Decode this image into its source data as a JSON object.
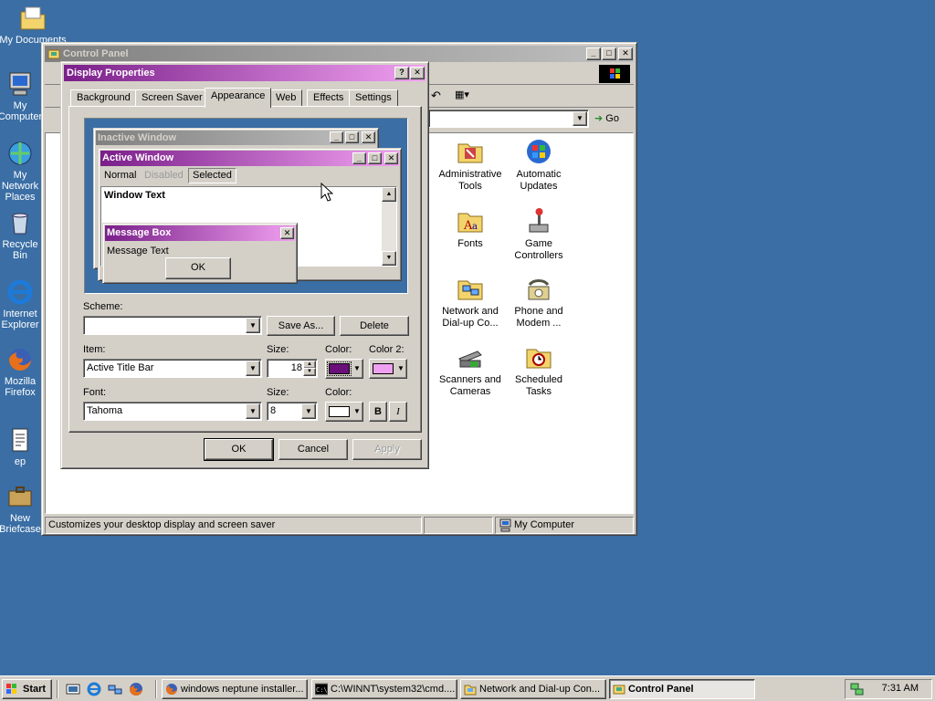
{
  "desktop": {
    "icons": [
      {
        "label": "My Documents",
        "icon": "folder-documents-icon"
      },
      {
        "label": "My Computer",
        "icon": "computer-icon"
      },
      {
        "label": "My Network Places",
        "icon": "network-icon"
      },
      {
        "label": "Recycle Bin",
        "icon": "recycle-bin-icon"
      },
      {
        "label": "Internet Explorer",
        "icon": "ie-icon"
      },
      {
        "label": "Mozilla Firefox",
        "icon": "firefox-icon"
      },
      {
        "label": "ep",
        "icon": "text-file-icon"
      },
      {
        "label": "New Briefcase",
        "icon": "briefcase-icon"
      }
    ]
  },
  "control_panel": {
    "title": "Control Panel",
    "go_label": "Go",
    "items": [
      {
        "label": "Administrative Tools",
        "icon": "admin-tools-icon"
      },
      {
        "label": "Automatic Updates",
        "icon": "windows-update-icon"
      },
      {
        "label": "Fonts",
        "icon": "fonts-folder-icon"
      },
      {
        "label": "Game Controllers",
        "icon": "joystick-icon"
      },
      {
        "label": "Network and Dial-up Co...",
        "icon": "network-folder-icon"
      },
      {
        "label": "Phone and Modem ...",
        "icon": "phone-icon"
      },
      {
        "label": "Scanners and Cameras",
        "icon": "scanner-icon"
      },
      {
        "label": "Scheduled Tasks",
        "icon": "scheduled-tasks-icon"
      }
    ],
    "status_text": "Customizes your desktop display and screen saver",
    "status_zone": "My Computer"
  },
  "display_properties": {
    "title": "Display Properties",
    "tabs": [
      "Background",
      "Screen Saver",
      "Appearance",
      "Web",
      "Effects",
      "Settings"
    ],
    "selected_tab": "Appearance",
    "preview": {
      "inactive_title": "Inactive Window",
      "active_title": "Active Window",
      "menu_normal": "Normal",
      "menu_disabled": "Disabled",
      "menu_selected": "Selected",
      "window_text": "Window Text",
      "msgbox_title": "Message Box",
      "msgbox_text": "Message Text",
      "msgbox_ok": "OK"
    },
    "scheme_label": "Scheme:",
    "scheme_value": "",
    "save_as": "Save As...",
    "delete": "Delete",
    "item_label": "Item:",
    "item_value": "Active Title Bar",
    "size_label": "Size:",
    "item_size": "18",
    "color_label": "Color:",
    "color2_label": "Color 2:",
    "item_color": "#6a0f7a",
    "item_color2": "#f0a0f0",
    "font_label": "Font:",
    "font_value": "Tahoma",
    "font_size_label": "Size:",
    "font_size": "8",
    "font_color_label": "Color:",
    "font_color": "#ffffff",
    "bold_label": "B",
    "italic_label": "I",
    "ok": "OK",
    "cancel": "Cancel",
    "apply": "Apply"
  },
  "taskbar": {
    "start": "Start",
    "tasks": [
      {
        "label": "windows neptune installer...",
        "icon": "firefox-icon"
      },
      {
        "label": "C:\\WINNT\\system32\\cmd....",
        "icon": "cmd-icon"
      },
      {
        "label": "Network and Dial-up Con...",
        "icon": "network-folder-icon"
      },
      {
        "label": "Control Panel",
        "icon": "control-panel-icon"
      }
    ],
    "clock": "7:31 AM"
  }
}
